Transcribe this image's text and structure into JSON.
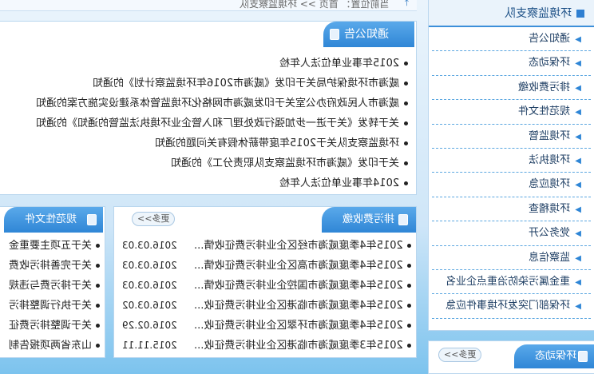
{
  "breadcrumb": {
    "text": "当前位置： 首页 >> 环境监察支队"
  },
  "notice": {
    "title": "通知公告",
    "items": [
      "2015年事业单位法人年检",
      "威海市环境保护局关于印发《威海市2016年环境监察计划》的通知",
      "威海市人民政府办公室关于印发威海市网格化环境监管体系建设实施方案的通知",
      "关于转发《关于进一步加强行政处理厂和入管企业环境执法监管的通知》的通知",
      "环境监察支队关于2015年度带薪休假有关问题的通知",
      "关于印发《威海市环境监察支队职责分工》的通知",
      "2014年事业单位法人年检"
    ]
  },
  "regulations": {
    "title": "规范性文件",
    "items": [
      "关于五项主要重金",
      "关于完善排污收费",
      "关于排污费与违规",
      "关于执行调整排污",
      "关于调整排污费征",
      "山东省两项报告制"
    ]
  },
  "fees": {
    "title": "排污费收缴",
    "more": "更多>>",
    "items": [
      {
        "title": "2015年4季度威海市经区企业排污费征收情...",
        "date": "2016.03.03"
      },
      {
        "title": "2015年4季度威海市高区企业排污费征收情...",
        "date": "2016.03.03"
      },
      {
        "title": "2015年4季度威海市国控企业排污费征收情...",
        "date": "2016.03.03"
      },
      {
        "title": "2015年4季度威海市临港区企业排污费征收...",
        "date": "2016.03.02"
      },
      {
        "title": "2015年4季度威海市环翠区企业排污费征收...",
        "date": "2016.02.29"
      },
      {
        "title": "2015年3季度威海市临港区企业排污费征收...",
        "date": "2015.11.11"
      }
    ]
  },
  "sidebar": {
    "title": "环境监察支队",
    "items": [
      "通知公告",
      "环保动态",
      "排污费收缴",
      "规范性文件",
      "环境监管",
      "环境执法",
      "环境应急",
      "环境稽查",
      "党务公开",
      "监察信息",
      "重金属污染防治重点企业名",
      "环保部门突发环境事件应急"
    ]
  },
  "env_news": {
    "title": "环保动态",
    "more": "更多>>"
  }
}
